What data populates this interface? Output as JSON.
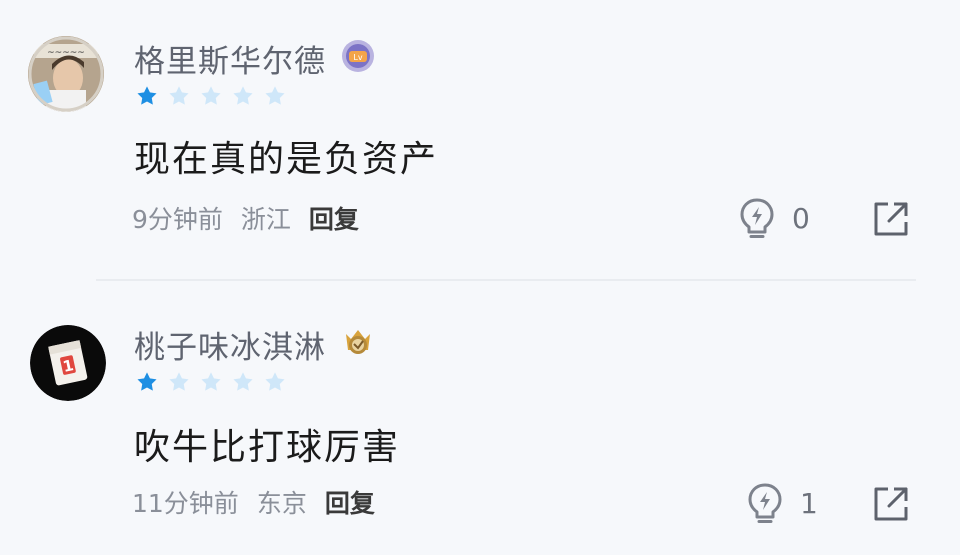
{
  "comments": [
    {
      "username": "格里斯华尔德",
      "rating": 1,
      "rating_max": 5,
      "content": "现在真的是负资产",
      "time": "9分钟前",
      "location": "浙江",
      "reply_label": "回复",
      "like_count": "0",
      "avatar_icon": "avatar-photo-man",
      "badge_icon": "level-badge-shield"
    },
    {
      "username": "桃子味冰淇淋",
      "rating": 1,
      "rating_max": 5,
      "content": "吹牛比打球厉害",
      "time": "11分钟前",
      "location": "东京",
      "reply_label": "回复",
      "like_count": "1",
      "avatar_icon": "avatar-calendar-one",
      "badge_icon": "level-badge-crown"
    }
  ],
  "colors": {
    "star_filled": "#1e8fe3",
    "star_empty": "#cfe7f9",
    "username": "#5f6470",
    "meta": "#8a8f99",
    "background": "#f6f8fb"
  }
}
